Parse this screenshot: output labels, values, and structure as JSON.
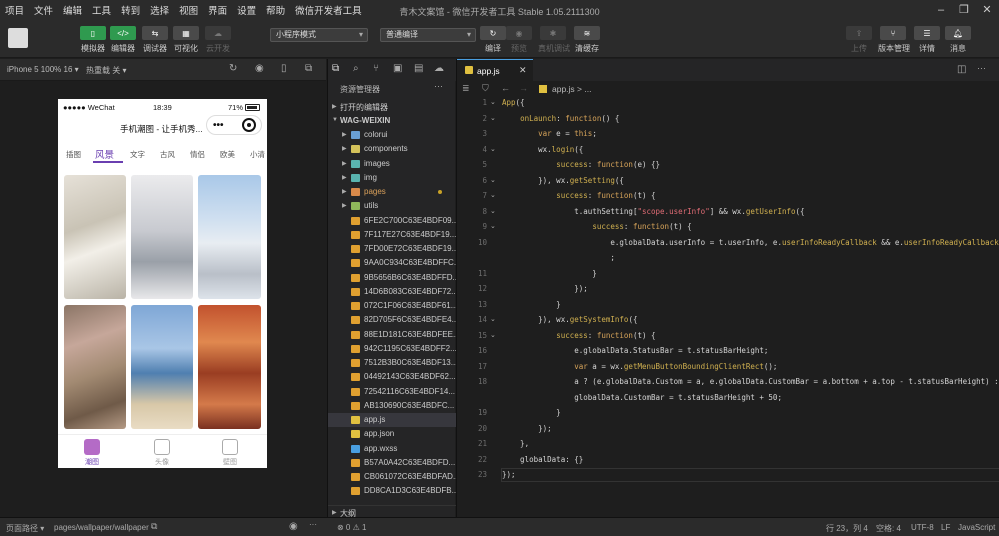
{
  "menu": [
    "项目",
    "文件",
    "编辑",
    "工具",
    "转到",
    "选择",
    "视图",
    "界面",
    "设置",
    "帮助",
    "微信开发者工具"
  ],
  "window_title": "青木文案馆 - 微信开发者工具 Stable 1.05.2111300",
  "toolbar": {
    "simulator": "模拟器",
    "editor": "编辑器",
    "debugger": "调试器",
    "visual": "可视化",
    "cloud": "云开发",
    "mode_select": "小程序模式",
    "compile_select": "普通编译",
    "compile": "编译",
    "preview": "预览",
    "device_debug": "真机调试",
    "clear_cache": "清缓存",
    "upload": "上传",
    "version": "版本管理",
    "details": "详情",
    "messages": "消息"
  },
  "simbar": {
    "device": "iPhone 5 100% 16 ▾",
    "hotreload": "热重载 关 ▾"
  },
  "phone": {
    "carrier": "●●●●● WeChat",
    "time": "18:39",
    "battery": "71%",
    "page_title": "手机潮图 - 让手机秀...",
    "capsule_dots": "•••",
    "tabs": [
      "插图",
      "风景",
      "文字",
      "古风",
      "情侣",
      "欧美",
      "小清"
    ],
    "active_tab": "风景",
    "tabbar": [
      "潮图",
      "头像",
      "壁图"
    ]
  },
  "explorer": {
    "title": "资源管理器",
    "open_editors": "打开的编辑器",
    "project": "WAG-WEIXIN",
    "items": [
      {
        "name": "colorui",
        "kind": "folder",
        "color": "#6a9fd4"
      },
      {
        "name": "components",
        "kind": "folder",
        "color": "#d4c25a"
      },
      {
        "name": "images",
        "kind": "folder",
        "color": "#5ab4b0"
      },
      {
        "name": "img",
        "kind": "folder",
        "color": "#5ab4b0"
      },
      {
        "name": "pages",
        "kind": "folder",
        "color": "#d98a4a"
      },
      {
        "name": "utils",
        "kind": "folder",
        "color": "#8fb75a"
      },
      {
        "name": "6FE2C700C63E4BDF09...",
        "kind": "img",
        "color": "#e0a030"
      },
      {
        "name": "7F117E27C63E4BDF19...",
        "kind": "img",
        "color": "#e0a030"
      },
      {
        "name": "7FD00E72C63E4BDF19...",
        "kind": "img",
        "color": "#e0a030"
      },
      {
        "name": "9AA0C934C63E4BDFFC...",
        "kind": "img",
        "color": "#e0a030"
      },
      {
        "name": "9B5656B6C63E4BDFFD...",
        "kind": "img",
        "color": "#e0a030"
      },
      {
        "name": "14D6B083C63E4BDF72...",
        "kind": "img",
        "color": "#e0a030"
      },
      {
        "name": "072C1F06C63E4BDF61...",
        "kind": "img",
        "color": "#e0a030"
      },
      {
        "name": "82D705F6C63E4BDFE4...",
        "kind": "img",
        "color": "#e0a030"
      },
      {
        "name": "88E1D181C63E4BDFEE...",
        "kind": "img",
        "color": "#e0a030"
      },
      {
        "name": "942C1195C63E4BDFF2...",
        "kind": "img",
        "color": "#e0a030"
      },
      {
        "name": "7512B3B0C63E4BDF13...",
        "kind": "img",
        "color": "#e0a030"
      },
      {
        "name": "04492143C63E4BDF62...",
        "kind": "img",
        "color": "#e0a030"
      },
      {
        "name": "72542116C63E4BDF14...",
        "kind": "img",
        "color": "#e0a030"
      },
      {
        "name": "AB130690C63E4BDFC...",
        "kind": "img",
        "color": "#e0a030"
      },
      {
        "name": "app.js",
        "kind": "js",
        "color": "#e0c040"
      },
      {
        "name": "app.json",
        "kind": "json",
        "color": "#e0c040"
      },
      {
        "name": "app.wxss",
        "kind": "wxss",
        "color": "#4a9fe0"
      },
      {
        "name": "B57A0A42C63E4BDFD...",
        "kind": "img",
        "color": "#e0a030"
      },
      {
        "name": "CB061072C63E4BDFAD...",
        "kind": "img",
        "color": "#e0a030"
      },
      {
        "name": "DD8CA1D3C63E4BDFB...",
        "kind": "img",
        "color": "#e0a030"
      }
    ],
    "outline": "大纲"
  },
  "editor": {
    "tab": "app.js",
    "breadcrumb": "app.js > ...",
    "lines": [
      {
        "n": "1",
        "t": "App({"
      },
      {
        "n": "2",
        "t": "    onLaunch: function() {"
      },
      {
        "n": "3",
        "t": "        var e = this;"
      },
      {
        "n": "4",
        "t": "        wx.login({"
      },
      {
        "n": "5",
        "t": "            success: function(e) {}"
      },
      {
        "n": "6",
        "t": "        }), wx.getSetting({"
      },
      {
        "n": "7",
        "t": "            success: function(t) {"
      },
      {
        "n": "8",
        "t": "                t.authSetting[\"scope.userInfo\"] && wx.getUserInfo({"
      },
      {
        "n": "9",
        "t": "                    success: function(t) {"
      },
      {
        "n": "10",
        "t": "                        e.globalData.userInfo = t.userInfo, e.userInfoReadyCallback && e.userInfoReadyCallback(t)"
      },
      {
        "n": "",
        "t": "                        ;"
      },
      {
        "n": "11",
        "t": "                    }"
      },
      {
        "n": "12",
        "t": "                });"
      },
      {
        "n": "13",
        "t": "            }"
      },
      {
        "n": "14",
        "t": "        }), wx.getSystemInfo({"
      },
      {
        "n": "15",
        "t": "            success: function(t) {"
      },
      {
        "n": "16",
        "t": "                e.globalData.StatusBar = t.statusBarHeight;"
      },
      {
        "n": "17",
        "t": "                var a = wx.getMenuButtonBoundingClientRect();"
      },
      {
        "n": "18",
        "t": "                a ? (e.globalData.Custom = a, e.globalData.CustomBar = a.bottom + a.top - t.statusBarHeight) : e."
      },
      {
        "n": "",
        "t": "                globalData.CustomBar = t.statusBarHeight + 50;"
      },
      {
        "n": "19",
        "t": "            }"
      },
      {
        "n": "20",
        "t": "        });"
      },
      {
        "n": "21",
        "t": "    },"
      },
      {
        "n": "22",
        "t": "    globalData: {}"
      },
      {
        "n": "23",
        "t": "});"
      }
    ]
  },
  "statusbar": {
    "page_path_label": "页面路径 ▾",
    "page_path": "pages/wallpaper/wallpaper",
    "problems": "⊗ 0 ⚠ 1",
    "cursor": "行 23，列 4",
    "spaces": "空格: 4",
    "encoding": "UTF-8",
    "eol": "LF",
    "language": "JavaScript"
  }
}
